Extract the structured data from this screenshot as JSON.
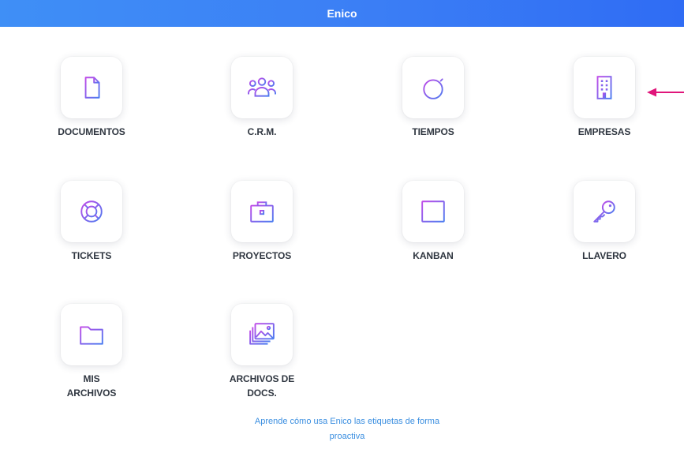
{
  "app": {
    "title": "Enico"
  },
  "tiles": [
    {
      "label": "DOCUMENTOS",
      "icon": "document-icon"
    },
    {
      "label": "C.R.M.",
      "icon": "users-group-icon"
    },
    {
      "label": "TIEMPOS",
      "icon": "stopwatch-icon"
    },
    {
      "label": "EMPRESAS",
      "icon": "building-icon"
    },
    {
      "label": "TICKETS",
      "icon": "lifebuoy-icon"
    },
    {
      "label": "PROYECTOS",
      "icon": "briefcase-icon"
    },
    {
      "label": "KANBAN",
      "icon": "kanban-board-icon"
    },
    {
      "label": "LLAVERO",
      "icon": "key-icon"
    },
    {
      "label": "MIS\nARCHIVOS",
      "icon": "folder-icon"
    },
    {
      "label": "ARCHIVOS DE\nDOCS.",
      "icon": "image-gallery-icon"
    }
  ],
  "footer": {
    "link_text": "Aprende cómo usa Enico las etiquetas de forma proactiva"
  },
  "colors": {
    "header_gradient_start": "#3f8ff6",
    "header_gradient_end": "#2f6cf4",
    "icon_gradient_start": "#c04ae8",
    "icon_gradient_end": "#4a7bf0",
    "annotation_arrow": "#e0157a",
    "link": "#3a8ee0"
  }
}
